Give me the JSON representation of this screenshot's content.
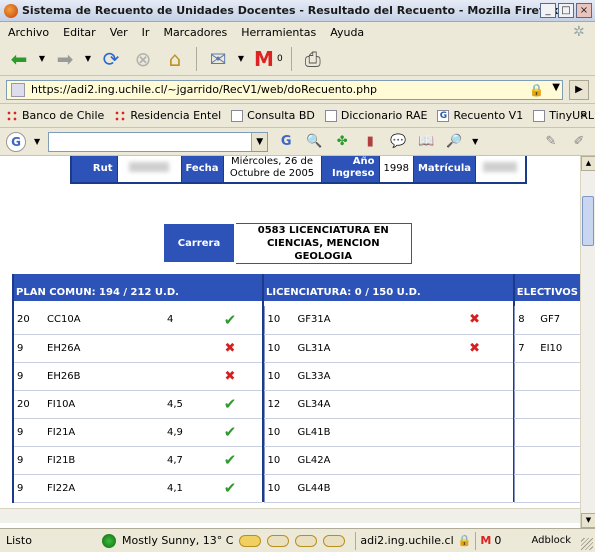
{
  "window": {
    "title": "Sistema de Recuento de Unidades Docentes - Resultado del Recuento - Mozilla Firefox",
    "controls": {
      "minimize": "_",
      "maximize": "□",
      "close": "×"
    }
  },
  "menu": [
    "Archivo",
    "Editar",
    "Ver",
    "Ir",
    "Marcadores",
    "Herramientas",
    "Ayuda"
  ],
  "gmail_count": "0",
  "url": "https://adi2.ing.uchile.cl/~jgarrido/RecV1/web/doRecuento.php",
  "bookmarks": [
    "Banco de Chile",
    "Residencia Entel",
    "Consulta BD",
    "Diccionario RAE",
    "Recuento V1",
    "TinyURL!"
  ],
  "bookmarks_more": "»",
  "google": {
    "search_value": ""
  },
  "student": {
    "rut_label": "Rut",
    "fecha_label": "Fecha",
    "fecha_value": "Miércoles, 26 de Octubre de 2005",
    "ingreso_label": "Año Ingreso",
    "ingreso_value": "1998",
    "matricula_label": "Matrícula"
  },
  "carrera": {
    "label": "Carrera",
    "value": "0583 LICENCIATURA EN CIENCIAS, MENCION GEOLOGIA"
  },
  "plans": {
    "comun": {
      "header": "PLAN COMUN: 194 / 212 U.D.",
      "rows": [
        {
          "ud": "20",
          "code": "CC10A",
          "grade": "4",
          "passed": true
        },
        {
          "ud": "9",
          "code": "EH26A",
          "grade": "",
          "passed": false
        },
        {
          "ud": "9",
          "code": "EH26B",
          "grade": "",
          "passed": false
        },
        {
          "ud": "20",
          "code": "FI10A",
          "grade": "4,5",
          "passed": true
        },
        {
          "ud": "9",
          "code": "FI21A",
          "grade": "4,9",
          "passed": true
        },
        {
          "ud": "9",
          "code": "FI21B",
          "grade": "4,7",
          "passed": true
        },
        {
          "ud": "9",
          "code": "FI22A",
          "grade": "4,1",
          "passed": true
        }
      ]
    },
    "licenciatura": {
      "header": "LICENCIATURA: 0 / 150 U.D.",
      "rows": [
        {
          "ud": "10",
          "code": "GF31A",
          "passed": false
        },
        {
          "ud": "10",
          "code": "GL31A",
          "passed": false
        },
        {
          "ud": "10",
          "code": "GL33A",
          "passed": null
        },
        {
          "ud": "12",
          "code": "GL34A",
          "passed": null
        },
        {
          "ud": "10",
          "code": "GL41B",
          "passed": null
        },
        {
          "ud": "10",
          "code": "GL42A",
          "passed": null
        },
        {
          "ud": "10",
          "code": "GL44B",
          "passed": null
        }
      ]
    },
    "electivos": {
      "header": "ELECTIVOS",
      "rows": [
        {
          "ud": "8",
          "code": "GF7"
        },
        {
          "ud": "7",
          "code": "EI10"
        }
      ]
    }
  },
  "status": {
    "ready": "Listo",
    "weather": "Mostly Sunny, 13° C",
    "host": "adi2.ing.uchile.cl",
    "mail_count": "0",
    "adblock": "Adblock"
  }
}
